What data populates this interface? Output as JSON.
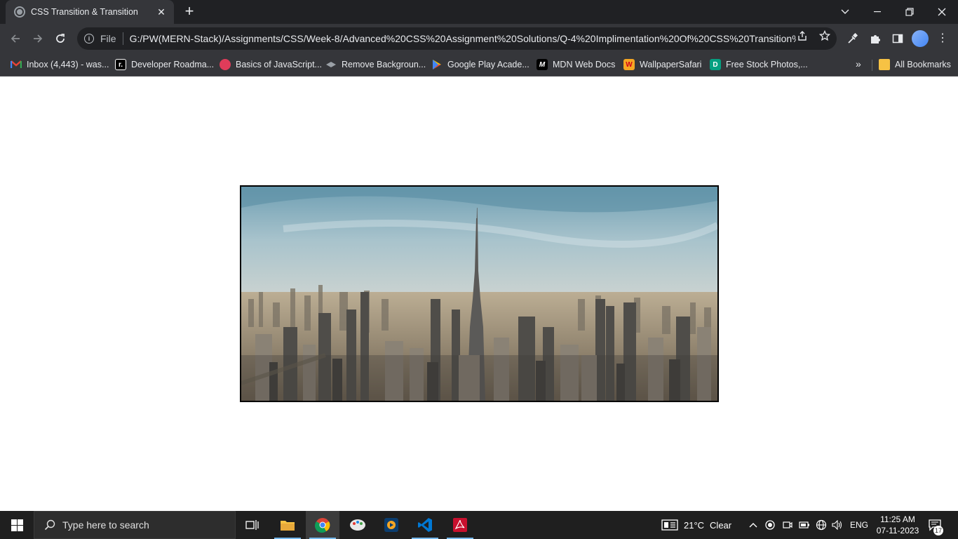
{
  "browser": {
    "tab": {
      "title": "CSS Transition & Transition"
    },
    "omnibox": {
      "scheme_label": "File",
      "url": "G:/PW(MERN-Stack)/Assignments/CSS/Week-8/Advanced%20CSS%20Assignment%20Solutions/Q-4%20Implimentation%20Of%20CSS%20Transition%..."
    },
    "bookmarks": [
      {
        "label": "Inbox (4,443) - was...",
        "icon": "gmail-icon"
      },
      {
        "label": "Developer Roadma...",
        "icon": "roadmap-icon"
      },
      {
        "label": "Basics of JavaScript...",
        "icon": "js-basics-icon"
      },
      {
        "label": "Remove Backgroun...",
        "icon": "remove-bg-icon"
      },
      {
        "label": "Google Play Acade...",
        "icon": "google-play-icon"
      },
      {
        "label": "MDN Web Docs",
        "icon": "mdn-icon"
      },
      {
        "label": "WallpaperSafari",
        "icon": "wallpapersafari-icon"
      },
      {
        "label": "Free Stock Photos,...",
        "icon": "stock-photos-icon"
      }
    ],
    "all_bookmarks_label": "All Bookmarks",
    "overflow_label": "»"
  },
  "page": {
    "image_alt": "Dubai city skyline with Burj Khalifa"
  },
  "taskbar": {
    "search_placeholder": "Type here to search",
    "weather_temp": "21°C",
    "weather_text": "Clear",
    "language": "ENG",
    "time": "11:25 AM",
    "date": "07-11-2023",
    "notification_count": "17"
  }
}
